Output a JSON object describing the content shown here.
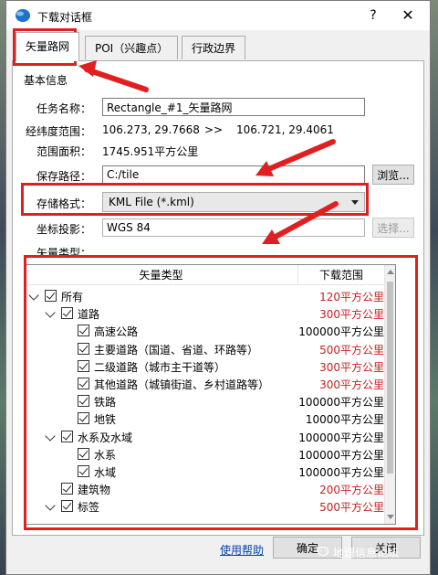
{
  "window": {
    "title": "下载对话框",
    "help": "?",
    "close": "✕"
  },
  "tabs": [
    {
      "label": "矢量路网",
      "active": true
    },
    {
      "label": "POI（兴趣点）",
      "active": false
    },
    {
      "label": "行政边界",
      "active": false
    }
  ],
  "basic_info": {
    "section_label": "基本信息",
    "task_name_label": "任务名称：",
    "task_name_value": "Rectangle_#1_矢量路网",
    "extent_label": "经纬度范围：",
    "extent_from": "106.273, 29.7668",
    "extent_sep": ">>",
    "extent_to": "106.721, 29.4061",
    "area_label": "范围面积：",
    "area_value": "1745.951平方公里",
    "save_path_label": "保存路径：",
    "save_path_value": "C:/tile",
    "browse_button": "浏览...",
    "format_label": "存储格式：",
    "format_value": "KML File (*.kml)",
    "projection_label": "坐标投影：",
    "projection_value": "WGS 84",
    "select_button": "选择...",
    "vector_type_label": "矢量类型："
  },
  "tree": {
    "col_name": "矢量类型",
    "col_range": "下载范围",
    "rows": [
      {
        "name": "所有",
        "range": "120平方公里",
        "red": true,
        "level": 0,
        "expand": true
      },
      {
        "name": "道路",
        "range": "300平方公里",
        "red": true,
        "level": 1,
        "expand": true
      },
      {
        "name": "高速公路",
        "range": "100000平方公里",
        "red": false,
        "level": 2,
        "expand": false
      },
      {
        "name": "主要道路（国道、省道、环路等）",
        "range": "500平方公里",
        "red": true,
        "level": 2,
        "expand": false
      },
      {
        "name": "二级道路（城市主干道等）",
        "range": "300平方公里",
        "red": true,
        "level": 2,
        "expand": false
      },
      {
        "name": "其他道路（城镇街道、乡村道路等）",
        "range": "300平方公里",
        "red": true,
        "level": 2,
        "expand": false
      },
      {
        "name": "铁路",
        "range": "100000平方公里",
        "red": false,
        "level": 2,
        "expand": false
      },
      {
        "name": "地铁",
        "range": "10000平方公里",
        "red": false,
        "level": 2,
        "expand": false
      },
      {
        "name": "水系及水域",
        "range": "100000平方公里",
        "red": false,
        "level": 1,
        "expand": true
      },
      {
        "name": "水系",
        "range": "100000平方公里",
        "red": false,
        "level": 2,
        "expand": false
      },
      {
        "name": "水域",
        "range": "100000平方公里",
        "red": false,
        "level": 2,
        "expand": false
      },
      {
        "name": "建筑物",
        "range": "200平方公里",
        "red": true,
        "level": 1,
        "expand": false
      },
      {
        "name": "标签",
        "range": "500平方公里",
        "red": true,
        "level": 1,
        "expand": true
      }
    ]
  },
  "footer": {
    "help_link": "使用帮助",
    "ok_button": "确定",
    "close_button": "关闭"
  },
  "watermark": "地理信息论坛",
  "colors": {
    "highlight": "#e02020",
    "range_red": "#c82020",
    "link": "#0645ad"
  }
}
